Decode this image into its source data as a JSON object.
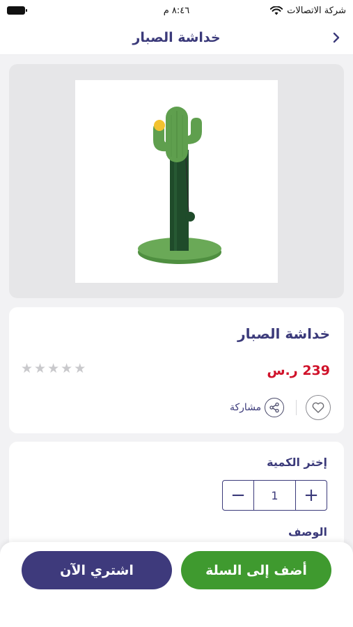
{
  "status_bar": {
    "carrier": "شركة الاتصالات",
    "time": "٨:٤٦ م"
  },
  "header": {
    "title": "خداشة الصبار",
    "back_icon": "chevron-right-icon"
  },
  "product": {
    "name": "خداشة الصبار",
    "price": "239 ر.س",
    "rating": 0,
    "rating_max": 5,
    "share_label": "مشاركة",
    "favorite_icon": "heart-outline-icon",
    "share_icon": "share-icon"
  },
  "quantity": {
    "label": "إختر الكمية",
    "value": "1",
    "decrement": "−",
    "increment": "+"
  },
  "description": {
    "label": "الوصف"
  },
  "actions": {
    "add_to_cart": "أضف إلى السلة",
    "buy_now": "اشتري الآن"
  },
  "colors": {
    "primary": "#3b3a7a",
    "price": "#d0122a",
    "cart_green": "#3f9a2f",
    "buy_purple": "#3e3a7c",
    "cactus_green": "#5f9f4e",
    "post_green": "#1f4b2a",
    "ball_yellow": "#f2c230"
  }
}
